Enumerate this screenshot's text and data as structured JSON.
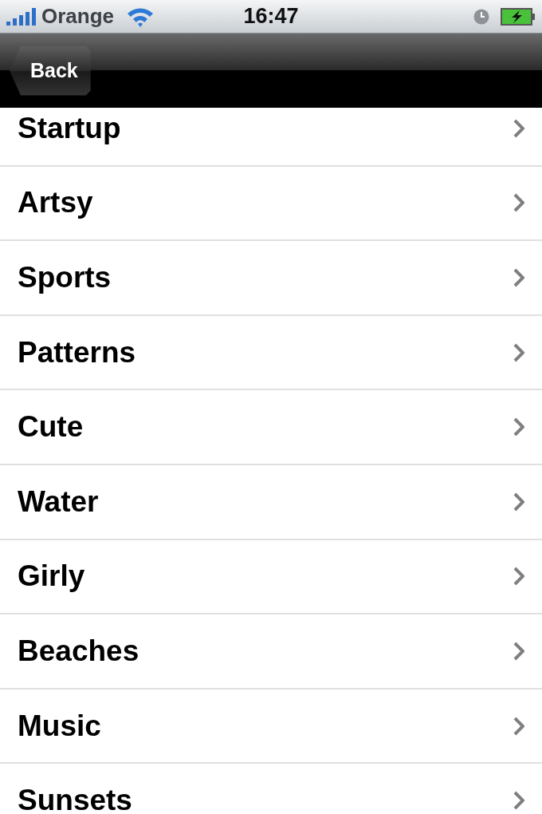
{
  "status_bar": {
    "carrier": "Orange",
    "time": "16:47"
  },
  "nav_bar": {
    "back_button": "Back"
  },
  "list": {
    "items": [
      {
        "label": "Startup"
      },
      {
        "label": "Artsy"
      },
      {
        "label": "Sports"
      },
      {
        "label": "Patterns"
      },
      {
        "label": "Cute"
      },
      {
        "label": "Water"
      },
      {
        "label": "Girly"
      },
      {
        "label": "Beaches"
      },
      {
        "label": "Music"
      },
      {
        "label": "Sunsets"
      }
    ]
  }
}
